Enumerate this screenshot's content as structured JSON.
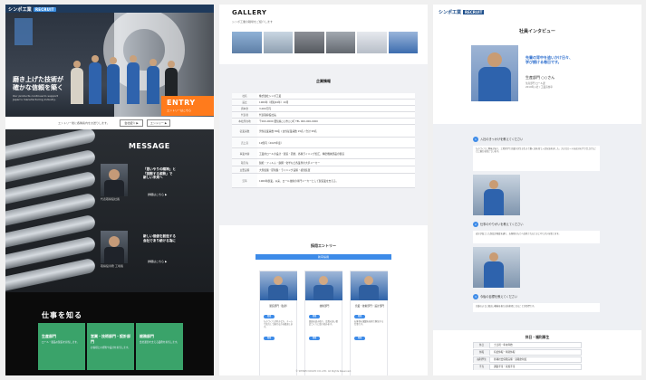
{
  "panel1": {
    "logo": "シンポ工業",
    "logo_tag": "RECRUIT",
    "hero": {
      "label": "",
      "title": "磨き上げた技術が\n確かな信頼を築く",
      "subtitle": "Our products continue to support Japan's manufacturing industry."
    },
    "entry": {
      "label": "ENTRY",
      "sub": "エントリーはこちら"
    },
    "infobar": {
      "text": "エントリー後に各種案内をお送りします。",
      "btn1": "会社紹介 ▶",
      "btn2": "エントリー ▶"
    },
    "message": {
      "title": "MESSAGE",
      "cards": [
        {
          "headline": "「思いやりの精神」と\n「挑戦する姿勢」で\n新しい未来へ",
          "name": "代表取締役社長",
          "more": "詳細はこちら ▶"
        },
        {
          "headline": "新しい価値を創造する\n会社であり続ける為に",
          "name": "取締役専務 工場長",
          "more": "詳細はこちら ▶"
        }
      ]
    },
    "jobs": {
      "title": "仕事を知る",
      "cards": [
        {
          "label": "生産部門",
          "desc": "ロール・製品の製造を担当します。",
          "color": "#34a56a"
        },
        {
          "label": "営業・技術部門・設計部門",
          "desc": "お客様との折衝や設計を担当します。",
          "color": "#2fa58a"
        },
        {
          "label": "総務部門",
          "desc": "会社運営を支える業務を担当します。",
          "color": "#38a46b"
        }
      ]
    }
  },
  "panel2": {
    "gallery_title": "GALLERY",
    "gallery_sub": "シンポ工業の職場をご紹介します",
    "gallery_colors": [
      "#6d8fb5",
      "#b7c4d2",
      "#7c8088",
      "#8a9099",
      "#d8dde4",
      "#4f79b4"
    ],
    "company_title": "企業情報",
    "company_rows": [
      {
        "k": "社名",
        "v": "株式会社シンポ工業"
      },
      {
        "k": "設立",
        "v": "1969年（昭和44年）10月"
      },
      {
        "k": "資本金",
        "v": "3,000万円"
      },
      {
        "k": "代表者",
        "v": "代表取締役社長"
      },
      {
        "k": "本社所在地",
        "v": "〒000-0000 愛知県○○市○○町 TEL 000-000-0000"
      },
      {
        "k": "従業員数",
        "v": "男性従業員数 80名 / 女性従業員数 15名 / 合計 95名"
      },
      {
        "k": "売上高",
        "v": "12億円（2023年度）"
      },
      {
        "k": "事業内容",
        "v": "工業用ロールの設計・製造・研磨、各種ライニング加工、精密機械部品の製造"
      },
      {
        "k": "取引先",
        "v": "製紙・フィルム・鉄鋼・化学など各業界の大手メーカー"
      },
      {
        "k": "主要設備",
        "v": "大型旋盤・研削盤・ライニング設備・検査装置"
      },
      {
        "k": "沿革",
        "v": "1969年創業。以来、ロール技術の専門メーカーとして製造業を支える。"
      }
    ],
    "recruit_title": "採用エントリー",
    "recruit_bar": "新卒採用",
    "recruit_cards": [
      {
        "name": "製造部門（生産）",
        "tag": "職種",
        "text": "ものづくりが好きな方、チームで協力して働ける方を歓迎します。"
      },
      {
        "name": "技術部門",
        "tag": "職種",
        "text": "図面を読み取り、品質の高い製品づくりに取り組みます。"
      },
      {
        "name": "営業・技術部門・設計部門",
        "tag": "職種",
        "text": "お客様の課題を技術で解決する仕事です。"
      }
    ],
    "footer": "© SHINPO KOGYO CO.,LTD. All Rights Reserved."
  },
  "panel3": {
    "logo": "シンポ工業",
    "logo_tag": "RECRUIT",
    "title": "社員インタビュー",
    "lead": "先輩の背中を追いかけ日々、\n学び続ける毎日です。",
    "name": "生産部門 ○○さん",
    "meta": "生産部門 ロール課\n2019年入社 / 工業高校卒",
    "qa": [
      {
        "q": "入社のきっかけを教えてください",
        "a": "ものづくりに興味があり、工場見学で先輩方が生き生きと働く姿を見て入社を決めました。大きなロールを自分の手で仕上げることに魅力を感じています。"
      },
      {
        "q": "仕事のやりがいを教えてください",
        "a": "自分が加工した製品が検査を通り、お客様のもとへ出荷されるときにやりがいを感じます。"
      },
      {
        "q": "今後の目標を教えてください",
        "a": "先輩のように幅広い機械を扱える技術者になることが目標です。"
      }
    ],
    "holiday_title": "休日・福利厚生",
    "holiday_rows": [
      {
        "k": "休日",
        "v": "土日祝・年末年始"
      },
      {
        "k": "休暇",
        "v": "有給休暇・特別休暇"
      },
      {
        "k": "福利厚生",
        "v": "各種社会保険完備・退職金制度"
      },
      {
        "k": "手当",
        "v": "通勤手当・家族手当"
      }
    ]
  }
}
